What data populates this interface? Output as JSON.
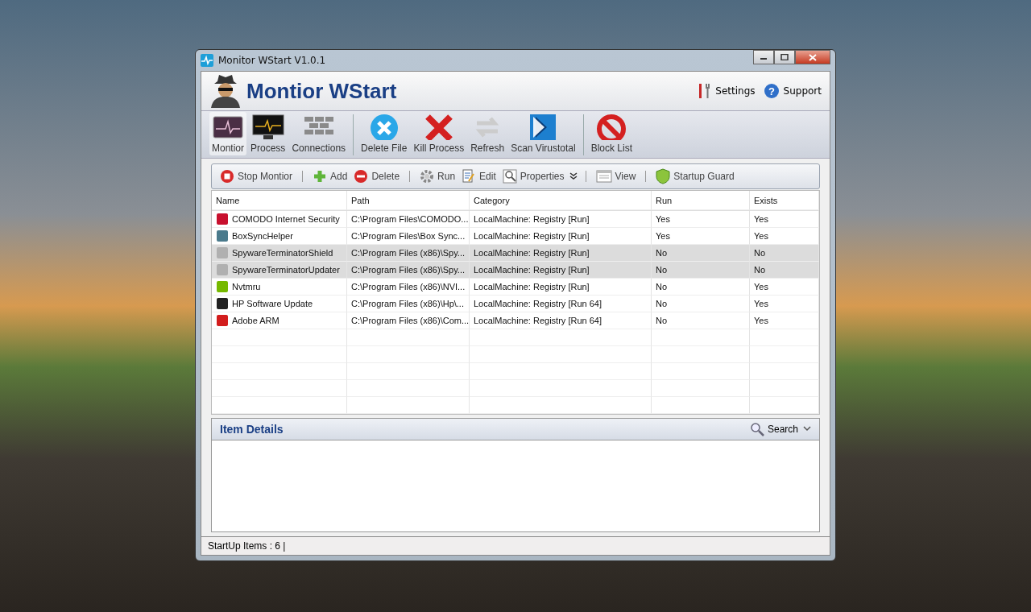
{
  "window": {
    "title": "Monitor WStart V1.0.1"
  },
  "header": {
    "title": "Montior WStart",
    "links": [
      "Settings",
      "Support"
    ],
    "help_glyph": "?"
  },
  "main_toolbar": [
    {
      "label": "Montior",
      "selected": true
    },
    {
      "label": "Process",
      "selected": false
    },
    {
      "label": "Connections",
      "selected": false
    },
    {
      "label": "Delete File",
      "selected": false
    },
    {
      "label": "Kill Process",
      "selected": false
    },
    {
      "label": "Refresh",
      "selected": false
    },
    {
      "label": "Scan Virustotal",
      "selected": false
    },
    {
      "label": "Block List",
      "selected": false
    }
  ],
  "sub_toolbar": [
    "Stop Montior",
    "Add",
    "Delete",
    "Run",
    "Edit",
    "Properties",
    "View",
    "Startup Guard"
  ],
  "table": {
    "columns": [
      "Name",
      "Path",
      "Category",
      "Run",
      "Exists"
    ],
    "rows": [
      {
        "cells": [
          "COMODO Internet Security",
          "C:\\Program Files\\COMODO...",
          "LocalMachine: Registry [Run]",
          "Yes",
          "Yes"
        ],
        "selected": false
      },
      {
        "cells": [
          "BoxSyncHelper",
          "C:\\Program Files\\Box Sync...",
          "LocalMachine: Registry [Run]",
          "Yes",
          "Yes"
        ],
        "selected": false
      },
      {
        "cells": [
          "SpywareTerminatorShield",
          "C:\\Program Files (x86)\\Spy...",
          "LocalMachine: Registry [Run]",
          "No",
          "No"
        ],
        "selected": true
      },
      {
        "cells": [
          "SpywareTerminatorUpdater",
          "C:\\Program Files (x86)\\Spy...",
          "LocalMachine: Registry [Run]",
          "No",
          "No"
        ],
        "selected": true
      },
      {
        "cells": [
          "Nvtmru",
          "C:\\Program Files (x86)\\NVI...",
          "LocalMachine: Registry [Run]",
          "No",
          "Yes"
        ],
        "selected": false
      },
      {
        "cells": [
          "HP Software Update",
          "C:\\Program Files (x86)\\Hp\\...",
          "LocalMachine: Registry [Run 64]",
          "No",
          "Yes"
        ],
        "selected": false
      },
      {
        "cells": [
          "Adobe ARM",
          "C:\\Program Files (x86)\\Com...",
          "LocalMachine: Registry [Run 64]",
          "No",
          "Yes"
        ],
        "selected": false
      }
    ]
  },
  "details": {
    "title": "Item Details",
    "search": "Search"
  },
  "status_bar": "StartUp Items : 6 |"
}
